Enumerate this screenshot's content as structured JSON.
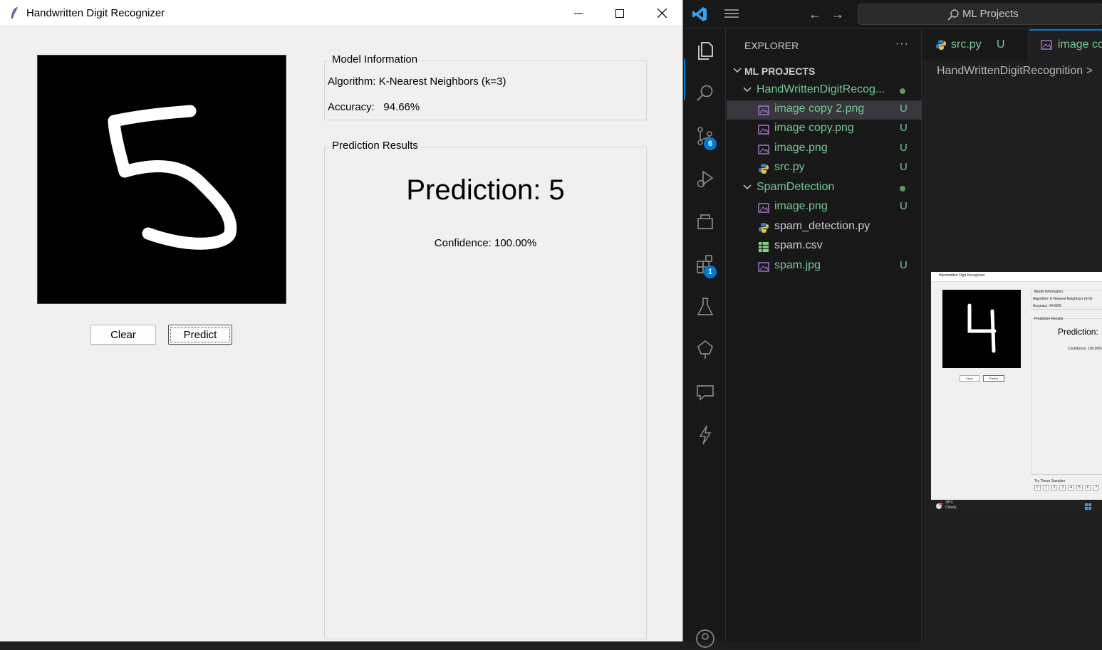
{
  "tk_app": {
    "title": "Handwritten Digit Recognizer",
    "buttons": {
      "clear": "Clear",
      "predict": "Predict"
    },
    "model_info": {
      "frame_title": "Model Information",
      "algorithm_line": "Algorithm: K-Nearest Neighbors (k=3)",
      "accuracy_line": "Accuracy:   94.66%"
    },
    "prediction": {
      "frame_title": "Prediction Results",
      "prediction_text": "Prediction: 5",
      "confidence_text": "Confidence: 100.00%"
    },
    "drawn_digit": "5"
  },
  "vscode": {
    "search_text": "ML Projects",
    "explorer_title": "EXPLORER",
    "more_actions": "···",
    "activity_badges": {
      "source_control": "6",
      "extensions": "1"
    },
    "workspace_label": "ML PROJECTS",
    "tree": [
      {
        "label": "HandWrittenDigitRecog...",
        "type": "folder",
        "status": "dot"
      },
      {
        "label": "image copy 2.png",
        "type": "image",
        "status": "U",
        "selected": true
      },
      {
        "label": "image copy.png",
        "type": "image",
        "status": "U"
      },
      {
        "label": "image.png",
        "type": "image",
        "status": "U"
      },
      {
        "label": "src.py",
        "type": "python",
        "status": "U"
      },
      {
        "label": "SpamDetection",
        "type": "folder",
        "status": "dot"
      },
      {
        "label": "image.png",
        "type": "image",
        "status": "U"
      },
      {
        "label": "spam_detection.py",
        "type": "python",
        "status": ""
      },
      {
        "label": "spam.csv",
        "type": "csv",
        "status": ""
      },
      {
        "label": "spam.jpg",
        "type": "image",
        "status": "U"
      }
    ],
    "tabs": [
      {
        "label": "src.py",
        "status": "U"
      },
      {
        "label": "image co"
      }
    ],
    "breadcrumb": "HandWrittenDigitRecognition >",
    "preview": {
      "title": "Handwritten Digit Recognizer",
      "model_info": "Model Information",
      "algorithm": "Algorithm: K-Nearest Neighbors (k=3)",
      "accuracy": "Accuracy:   94.66%",
      "prediction_results": "Prediction Results",
      "prediction": "Prediction:",
      "confidence": "Confidence: 100.00%",
      "clear": "Clear",
      "predict": "Predict",
      "samples_label": "Try These Samples",
      "samples": [
        "0",
        "1",
        "2",
        "3",
        "4",
        "5",
        "6",
        "7"
      ],
      "weather_temp": "28°C",
      "weather_text": "Cloudy"
    },
    "colors": {
      "accent": "#0078d4",
      "untracked": "#73c991",
      "folder_modified": "#73c991"
    }
  }
}
